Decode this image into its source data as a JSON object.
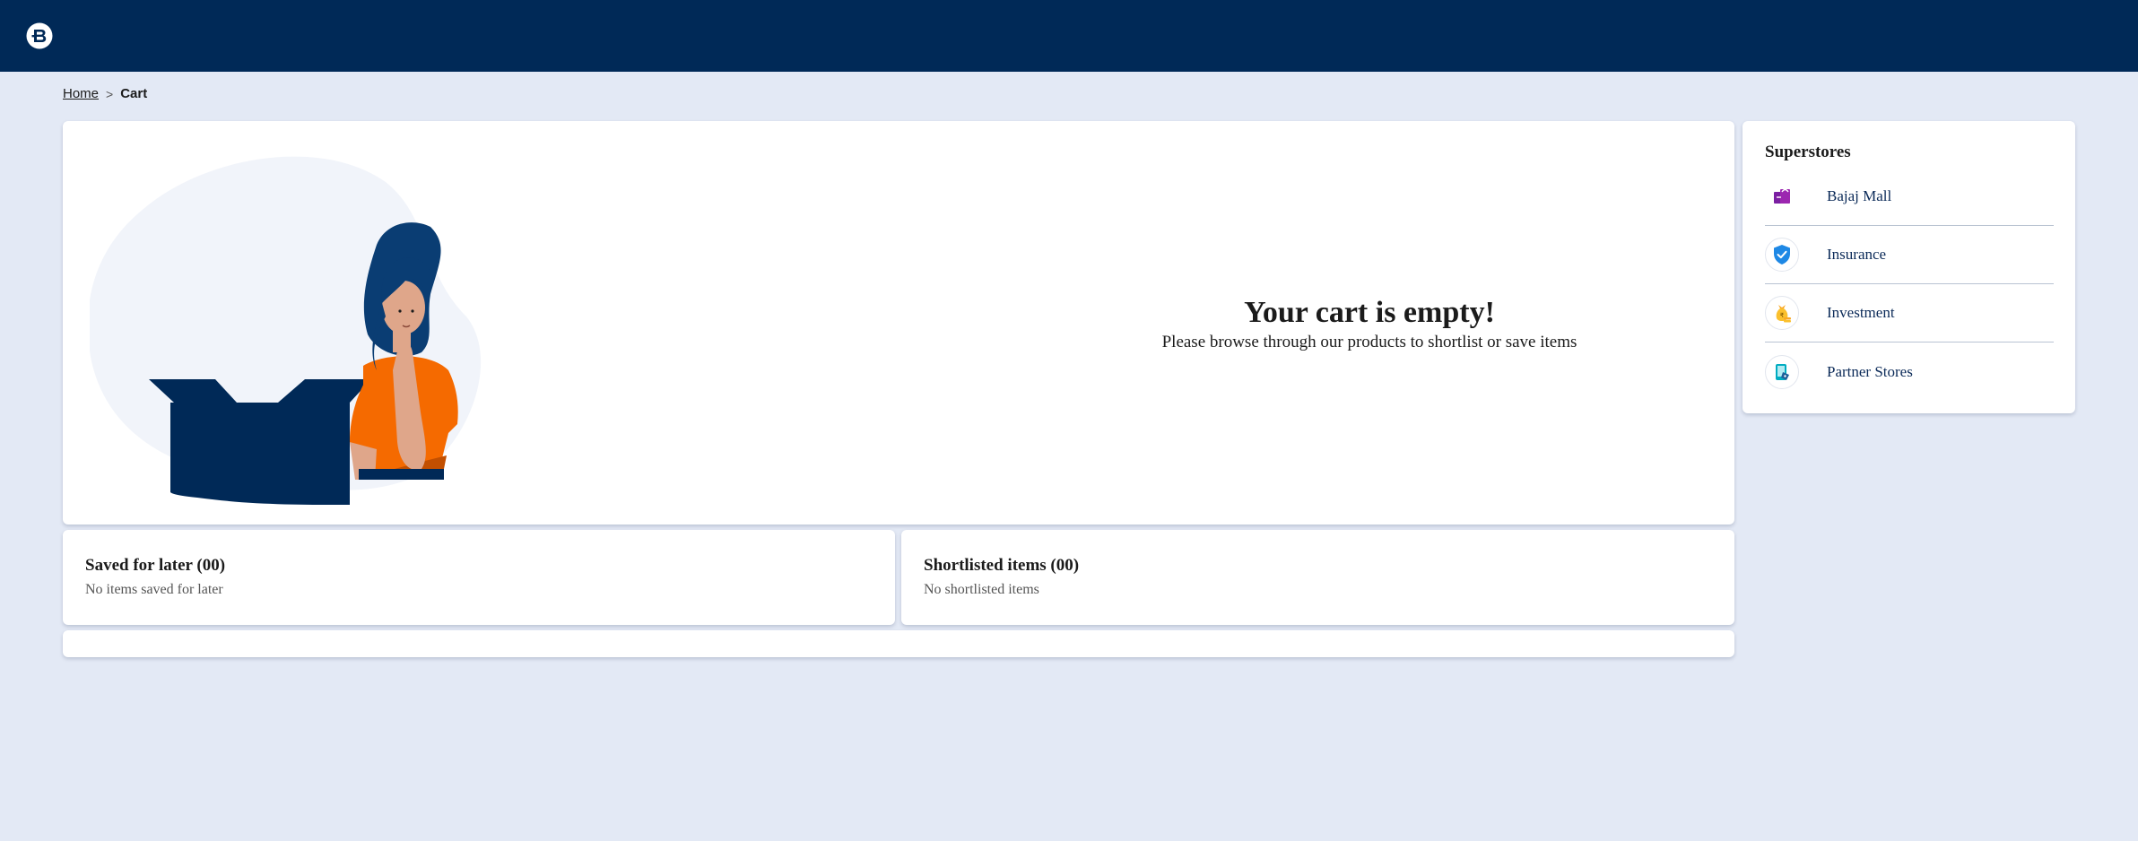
{
  "header": {
    "logo_icon": "bajaj-finserv-logo-icon",
    "background": "#002957"
  },
  "breadcrumb": {
    "home": "Home",
    "separator": ">",
    "current": "Cart"
  },
  "empty_cart": {
    "title": "Your cart is empty!",
    "subtitle": "Please browse through our products to shortlist or save items",
    "illustration": "woman-with-empty-box-illustration"
  },
  "saved_for_later": {
    "title": "Saved for later (00)",
    "message": "No items saved for later"
  },
  "shortlisted": {
    "title": "Shortlisted items (00)",
    "message": "No shortlisted items"
  },
  "superstores": {
    "title": "Superstores",
    "items": [
      {
        "label": "Bajaj Mall",
        "icon": "shopping-bags-icon"
      },
      {
        "label": "Insurance",
        "icon": "shield-check-icon"
      },
      {
        "label": "Investment",
        "icon": "money-bag-icon"
      },
      {
        "label": "Partner Stores",
        "icon": "partner-store-icon"
      }
    ]
  }
}
